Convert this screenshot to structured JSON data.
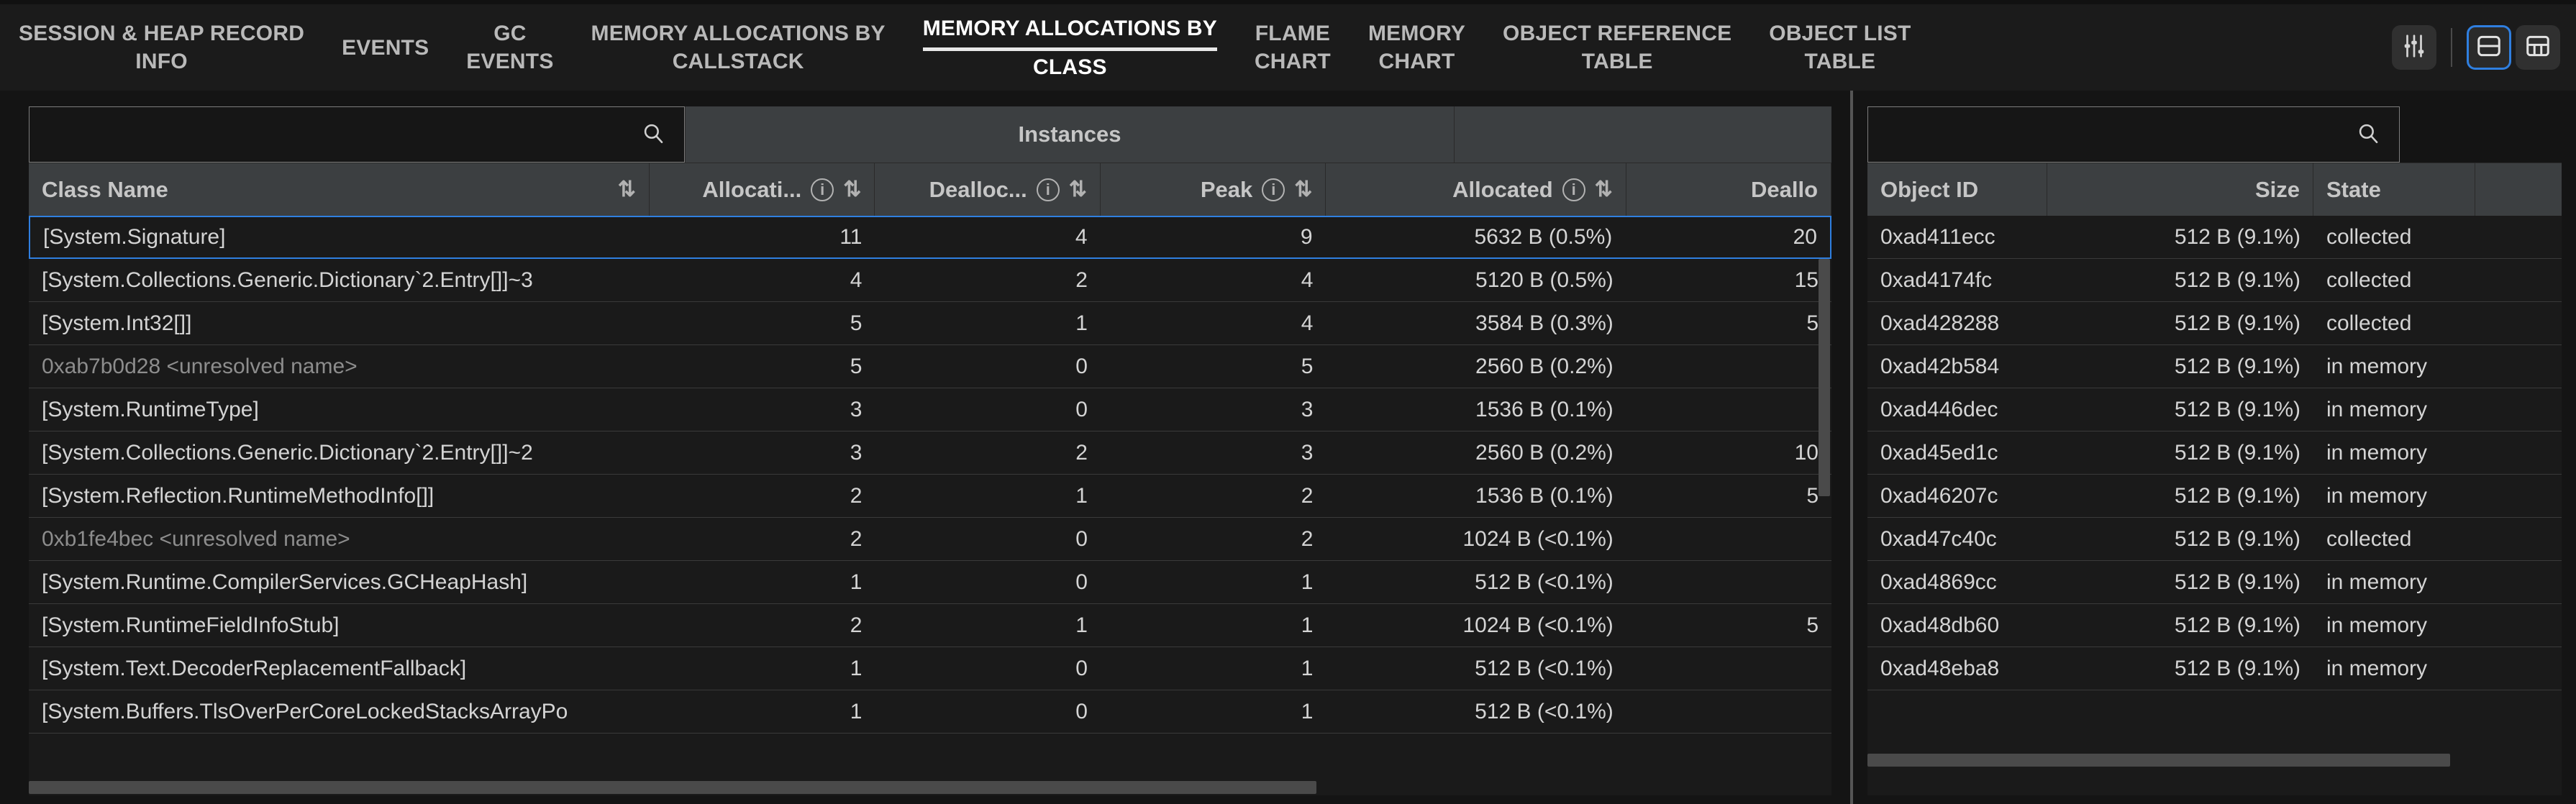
{
  "tabs": [
    {
      "line1": "SESSION & HEAP RECORD",
      "line2": "INFO",
      "active": false,
      "name": "tab-session-heap-record-info"
    },
    {
      "line1": "EVENTS",
      "line2": "",
      "active": false,
      "name": "tab-events"
    },
    {
      "line1": "GC",
      "line2": "EVENTS",
      "active": false,
      "name": "tab-gc-events"
    },
    {
      "line1": "MEMORY ALLOCATIONS BY",
      "line2": "CALLSTACK",
      "active": false,
      "name": "tab-memory-allocations-by-callstack"
    },
    {
      "line1": "MEMORY ALLOCATIONS BY",
      "line2": "CLASS",
      "active": true,
      "name": "tab-memory-allocations-by-class"
    },
    {
      "line1": "FLAME",
      "line2": "CHART",
      "active": false,
      "name": "tab-flame-chart"
    },
    {
      "line1": "MEMORY",
      "line2": "CHART",
      "active": false,
      "name": "tab-memory-chart"
    },
    {
      "line1": "OBJECT REFERENCE",
      "line2": "TABLE",
      "active": false,
      "name": "tab-object-reference-table"
    },
    {
      "line1": "OBJECT LIST",
      "line2": "TABLE",
      "active": false,
      "name": "tab-object-list-table"
    }
  ],
  "toolbar": {
    "filter_icon": "sliders-icon",
    "layout_split_icon": "layout-horizontal-split-icon",
    "layout_grid_icon": "layout-grid-icon",
    "selected_layout": "layout-horizontal-split-icon",
    "accent_color": "#2f7fe0"
  },
  "left_panel": {
    "search": {
      "value": "",
      "placeholder": "",
      "icon": "search-icon"
    },
    "group_header": "Instances",
    "columns": [
      {
        "label": "Class Name",
        "align": "left",
        "info": false,
        "sort": true
      },
      {
        "label": "Allocati...",
        "align": "right",
        "info": true,
        "sort": true
      },
      {
        "label": "Dealloc...",
        "align": "right",
        "info": true,
        "sort": true
      },
      {
        "label": "Peak",
        "align": "right",
        "info": true,
        "sort": true
      },
      {
        "label": "Allocated",
        "align": "right",
        "info": true,
        "sort": true
      },
      {
        "label": "Deallo",
        "align": "right",
        "info": false,
        "sort": false
      }
    ],
    "rows": [
      {
        "class_name": "[System.Signature]",
        "unresolved": false,
        "selected": true,
        "allocations": "11",
        "deallocations": "4",
        "peak": "9",
        "allocated": "5632 B (0.5%)",
        "deallocated": "20"
      },
      {
        "class_name": "[System.Collections.Generic.Dictionary`2.Entry[]]~3",
        "unresolved": false,
        "selected": false,
        "allocations": "4",
        "deallocations": "2",
        "peak": "4",
        "allocated": "5120 B (0.5%)",
        "deallocated": "15"
      },
      {
        "class_name": "[System.Int32[]]",
        "unresolved": false,
        "selected": false,
        "allocations": "5",
        "deallocations": "1",
        "peak": "4",
        "allocated": "3584 B (0.3%)",
        "deallocated": "5"
      },
      {
        "class_name": "0xab7b0d28 <unresolved name>",
        "unresolved": true,
        "selected": false,
        "allocations": "5",
        "deallocations": "0",
        "peak": "5",
        "allocated": "2560 B (0.2%)",
        "deallocated": ""
      },
      {
        "class_name": "[System.RuntimeType]",
        "unresolved": false,
        "selected": false,
        "allocations": "3",
        "deallocations": "0",
        "peak": "3",
        "allocated": "1536 B (0.1%)",
        "deallocated": ""
      },
      {
        "class_name": "[System.Collections.Generic.Dictionary`2.Entry[]]~2",
        "unresolved": false,
        "selected": false,
        "allocations": "3",
        "deallocations": "2",
        "peak": "3",
        "allocated": "2560 B (0.2%)",
        "deallocated": "10"
      },
      {
        "class_name": "[System.Reflection.RuntimeMethodInfo[]]",
        "unresolved": false,
        "selected": false,
        "allocations": "2",
        "deallocations": "1",
        "peak": "2",
        "allocated": "1536 B (0.1%)",
        "deallocated": "5"
      },
      {
        "class_name": "0xb1fe4bec <unresolved name>",
        "unresolved": true,
        "selected": false,
        "allocations": "2",
        "deallocations": "0",
        "peak": "2",
        "allocated": "1024 B (<0.1%)",
        "deallocated": ""
      },
      {
        "class_name": "[System.Runtime.CompilerServices.GCHeapHash]",
        "unresolved": false,
        "selected": false,
        "allocations": "1",
        "deallocations": "0",
        "peak": "1",
        "allocated": "512 B (<0.1%)",
        "deallocated": ""
      },
      {
        "class_name": "[System.RuntimeFieldInfoStub]",
        "unresolved": false,
        "selected": false,
        "allocations": "2",
        "deallocations": "1",
        "peak": "1",
        "allocated": "1024 B (<0.1%)",
        "deallocated": "5"
      },
      {
        "class_name": "[System.Text.DecoderReplacementFallback]",
        "unresolved": false,
        "selected": false,
        "allocations": "1",
        "deallocations": "0",
        "peak": "1",
        "allocated": "512 B (<0.1%)",
        "deallocated": ""
      },
      {
        "class_name": "[System.Buffers.TlsOverPerCoreLockedStacksArrayPo",
        "unresolved": false,
        "selected": false,
        "allocations": "1",
        "deallocations": "0",
        "peak": "1",
        "allocated": "512 B (<0.1%)",
        "deallocated": ""
      }
    ]
  },
  "right_panel": {
    "search": {
      "value": "",
      "placeholder": "",
      "icon": "search-icon"
    },
    "columns": [
      {
        "label": "Object ID",
        "align": "left"
      },
      {
        "label": "Size",
        "align": "right"
      },
      {
        "label": "State",
        "align": "left"
      }
    ],
    "rows": [
      {
        "object_id": "0xad411ecc",
        "size": "512 B (9.1%)",
        "state": "collected"
      },
      {
        "object_id": "0xad4174fc",
        "size": "512 B (9.1%)",
        "state": "collected"
      },
      {
        "object_id": "0xad428288",
        "size": "512 B (9.1%)",
        "state": "collected"
      },
      {
        "object_id": "0xad42b584",
        "size": "512 B (9.1%)",
        "state": "in memory"
      },
      {
        "object_id": "0xad446dec",
        "size": "512 B (9.1%)",
        "state": "in memory"
      },
      {
        "object_id": "0xad45ed1c",
        "size": "512 B (9.1%)",
        "state": "in memory"
      },
      {
        "object_id": "0xad46207c",
        "size": "512 B (9.1%)",
        "state": "in memory"
      },
      {
        "object_id": "0xad47c40c",
        "size": "512 B (9.1%)",
        "state": "collected"
      },
      {
        "object_id": "0xad4869cc",
        "size": "512 B (9.1%)",
        "state": "in memory"
      },
      {
        "object_id": "0xad48db60",
        "size": "512 B (9.1%)",
        "state": "in memory"
      },
      {
        "object_id": "0xad48eba8",
        "size": "512 B (9.1%)",
        "state": "in memory"
      }
    ]
  }
}
